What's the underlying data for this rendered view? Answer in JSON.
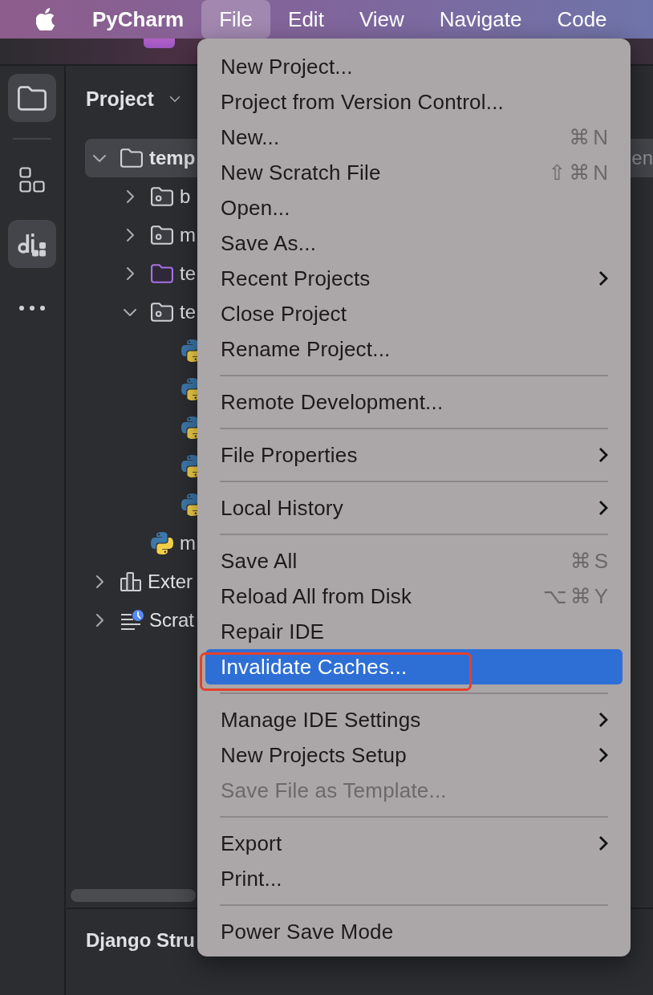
{
  "menu_bar": {
    "items": [
      {
        "kind": "app",
        "label": "PyCharm",
        "selected": false
      },
      {
        "kind": "menu",
        "label": "File",
        "selected": true
      },
      {
        "kind": "menu",
        "label": "Edit",
        "selected": false
      },
      {
        "kind": "menu",
        "label": "View",
        "selected": false
      },
      {
        "kind": "menu",
        "label": "Navigate",
        "selected": false
      },
      {
        "kind": "menu",
        "label": "Code",
        "selected": false
      }
    ]
  },
  "tool_strip": {
    "buttons": [
      {
        "kind": "project",
        "selected": true
      },
      {
        "kind": "structure",
        "selected": false
      },
      {
        "kind": "django",
        "selected": true
      },
      {
        "kind": "more",
        "selected": false
      }
    ]
  },
  "project_panel": {
    "title": "Project",
    "tree": [
      {
        "kind": "project-root",
        "label": "temp",
        "secondary": "en",
        "expanded": true,
        "selected": true,
        "children": [
          {
            "kind": "module-folder",
            "label": "b",
            "expanded": false,
            "selected": false
          },
          {
            "kind": "module-folder",
            "label": "m",
            "expanded": false,
            "selected": false
          },
          {
            "kind": "resource-folder",
            "label": "te",
            "expanded": false,
            "selected": false
          },
          {
            "kind": "module-folder",
            "label": "te",
            "expanded": true,
            "selected": false,
            "children": [
              {
                "kind": "python-file",
                "selected": false
              },
              {
                "kind": "python-file",
                "selected": false
              },
              {
                "kind": "python-file",
                "selected": false
              },
              {
                "kind": "python-file",
                "selected": false
              },
              {
                "kind": "python-file",
                "selected": false
              }
            ]
          },
          {
            "kind": "python-file",
            "label": "m",
            "selected": false
          }
        ]
      },
      {
        "kind": "library",
        "label": "Exter",
        "expanded": false,
        "selected": false
      },
      {
        "kind": "scratches",
        "label": "Scrat",
        "expanded": false,
        "selected": false
      }
    ]
  },
  "structure_panel": {
    "title": "Django Stru"
  },
  "file_menu": {
    "items": [
      {
        "kind": "item",
        "label": "New Project...",
        "selected": false,
        "disabled": false,
        "submenu": false,
        "annotated": false
      },
      {
        "kind": "item",
        "label": "Project from Version Control...",
        "selected": false,
        "disabled": false,
        "submenu": false,
        "annotated": false
      },
      {
        "kind": "item",
        "label": "New...",
        "shortcut": "⌘N",
        "selected": false,
        "disabled": false,
        "submenu": false,
        "annotated": false
      },
      {
        "kind": "item",
        "label": "New Scratch File",
        "shortcut": "⇧⌘N",
        "selected": false,
        "disabled": false,
        "submenu": false,
        "annotated": false
      },
      {
        "kind": "item",
        "label": "Open...",
        "selected": false,
        "disabled": false,
        "submenu": false,
        "annotated": false
      },
      {
        "kind": "item",
        "label": "Save As...",
        "selected": false,
        "disabled": false,
        "submenu": false,
        "annotated": false
      },
      {
        "kind": "item",
        "label": "Recent Projects",
        "selected": false,
        "disabled": false,
        "submenu": true,
        "annotated": false
      },
      {
        "kind": "item",
        "label": "Close Project",
        "selected": false,
        "disabled": false,
        "submenu": false,
        "annotated": false
      },
      {
        "kind": "item",
        "label": "Rename Project...",
        "selected": false,
        "disabled": false,
        "submenu": false,
        "annotated": false
      },
      {
        "kind": "separator"
      },
      {
        "kind": "item",
        "label": "Remote Development...",
        "selected": false,
        "disabled": false,
        "submenu": false,
        "annotated": false
      },
      {
        "kind": "separator"
      },
      {
        "kind": "item",
        "label": "File Properties",
        "selected": false,
        "disabled": false,
        "submenu": true,
        "annotated": false
      },
      {
        "kind": "separator"
      },
      {
        "kind": "item",
        "label": "Local History",
        "selected": false,
        "disabled": false,
        "submenu": true,
        "annotated": false
      },
      {
        "kind": "separator"
      },
      {
        "kind": "item",
        "label": "Save All",
        "shortcut": "⌘S",
        "selected": false,
        "disabled": false,
        "submenu": false,
        "annotated": false
      },
      {
        "kind": "item",
        "label": "Reload All from Disk",
        "shortcut": "⌥⌘Y",
        "selected": false,
        "disabled": false,
        "submenu": false,
        "annotated": false
      },
      {
        "kind": "item",
        "label": "Repair IDE",
        "selected": false,
        "disabled": false,
        "submenu": false,
        "annotated": false
      },
      {
        "kind": "item",
        "label": "Invalidate Caches...",
        "selected": true,
        "disabled": false,
        "submenu": false,
        "annotated": true
      },
      {
        "kind": "separator"
      },
      {
        "kind": "item",
        "label": "Manage IDE Settings",
        "selected": false,
        "disabled": false,
        "submenu": true,
        "annotated": false
      },
      {
        "kind": "item",
        "label": "New Projects Setup",
        "selected": false,
        "disabled": false,
        "submenu": true,
        "annotated": false
      },
      {
        "kind": "item",
        "label": "Save File as Template...",
        "selected": false,
        "disabled": true,
        "submenu": false,
        "annotated": false
      },
      {
        "kind": "separator"
      },
      {
        "kind": "item",
        "label": "Export",
        "selected": false,
        "disabled": false,
        "submenu": true,
        "annotated": false
      },
      {
        "kind": "item",
        "label": "Print...",
        "selected": false,
        "disabled": false,
        "submenu": false,
        "annotated": false
      },
      {
        "kind": "separator"
      },
      {
        "kind": "item",
        "label": "Power Save Mode",
        "selected": false,
        "disabled": false,
        "submenu": false,
        "annotated": false
      }
    ]
  }
}
